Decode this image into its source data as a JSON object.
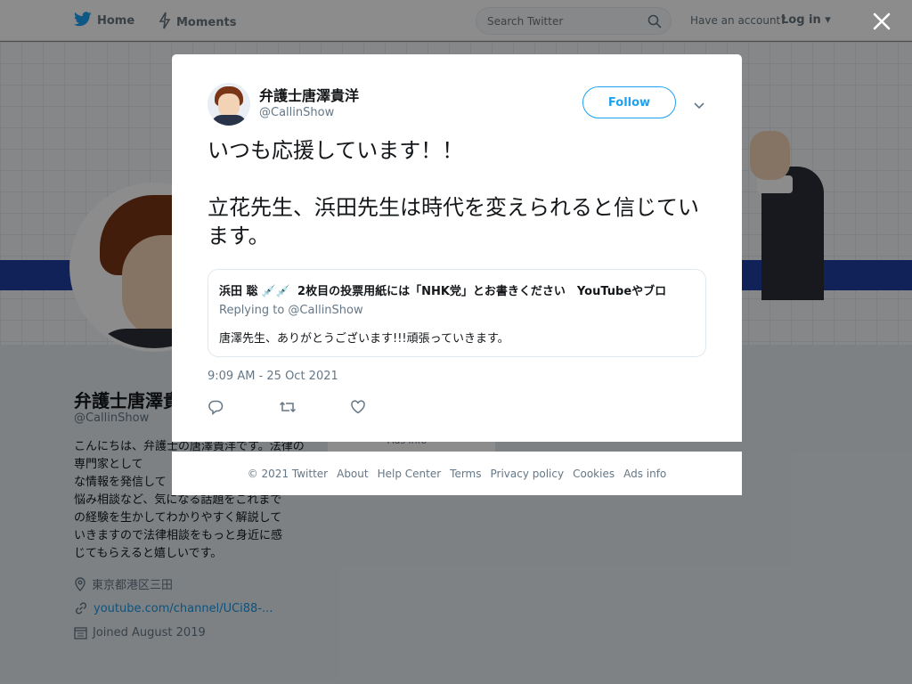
{
  "nav": {
    "home_label": "Home",
    "moments_label": "Moments",
    "search_placeholder": "Search Twitter",
    "have_account": "Have an account?",
    "login_label": "Log in"
  },
  "profile": {
    "name": "弁護士唐澤貴",
    "handle": "@CallinShow",
    "bio": "こんにちは、弁護士の唐澤貴洋です。法律の専門家として\nな情報を発信して\n悩み相談など、気になる話題をこれまで\nの経験を生かしてわかりやすく解説して\nいきますので法律相談をもっと身近に感\nじてもらえると嬉しいです。",
    "location": "東京都港区三田",
    "url": "youtube.com/channel/UCi88-...",
    "joined": "Joined August 2019",
    "card_text": "Ads info"
  },
  "tweet": {
    "author_name": "弁護士唐澤貴洋",
    "author_handle": "@CallinShow",
    "follow_label": "Follow",
    "text": "いつも応援しています！！\n\n立花先生、浜田先生は時代を変えられると信じています。",
    "timestamp": "9:09 AM - 25 Oct 2021",
    "quote": {
      "name": "浜田 聡",
      "emoji": "💉💉",
      "headline": "2枚目の投票用紙には「NHK党」とお書きください　YouTubeやブロ",
      "replying_to": "Replying to @CallinShow",
      "text": "唐澤先生、ありがとうございます!!!頑張っていきます。"
    }
  },
  "footer": {
    "copyright": "© 2021 Twitter",
    "links": [
      "About",
      "Help Center",
      "Terms",
      "Privacy policy",
      "Cookies",
      "Ads info"
    ]
  },
  "colors": {
    "brand": "#1da1f2",
    "text_secondary": "#657786"
  }
}
